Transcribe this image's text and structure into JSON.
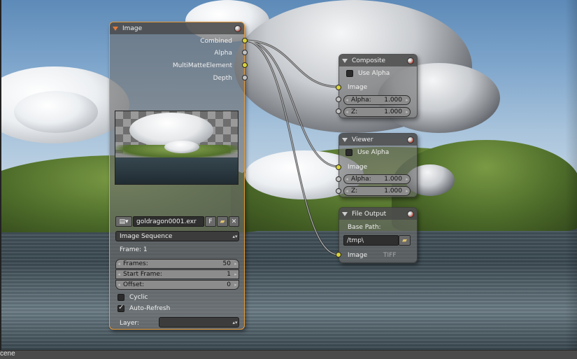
{
  "scene": {
    "status_label": "cene"
  },
  "image_node": {
    "title": "Image",
    "outputs": [
      "Combined",
      "Alpha",
      "MultiMatteElement",
      "Depth"
    ],
    "file_name": "goldragon0001.exr",
    "fake_user_label": "F",
    "source_type": "Image Sequence",
    "frame_info": "Frame: 1",
    "frames_label": "Frames:",
    "frames_value": "50",
    "start_frame_label": "Start Frame:",
    "start_frame_value": "1",
    "offset_label": "Offset:",
    "offset_value": "0",
    "cyclic_label": "Cyclic",
    "auto_refresh_label": "Auto-Refresh",
    "layer_label": "Layer:",
    "layer_value": ""
  },
  "composite_node": {
    "title": "Composite",
    "use_alpha_label": "Use Alpha",
    "image_label": "Image",
    "alpha_label": "Alpha:",
    "alpha_value": "1.000",
    "z_label": "Z:",
    "z_value": "1.000"
  },
  "viewer_node": {
    "title": "Viewer",
    "use_alpha_label": "Use Alpha",
    "image_label": "Image",
    "alpha_label": "Alpha:",
    "alpha_value": "1.000",
    "z_label": "Z:",
    "z_value": "1.000"
  },
  "file_output_node": {
    "title": "File Output",
    "base_path_label": "Base Path:",
    "base_path_value": "/tmp\\",
    "image_label": "Image",
    "format_label": "TIFF"
  }
}
